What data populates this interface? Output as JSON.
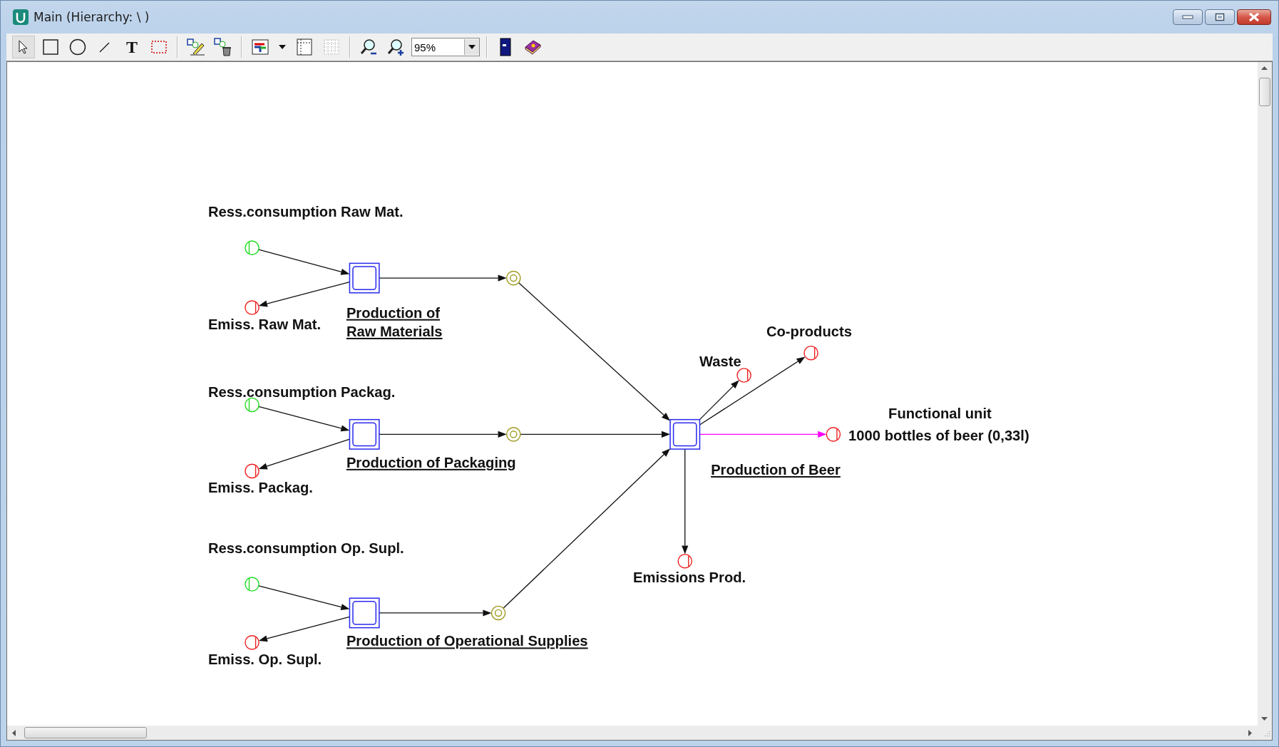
{
  "window": {
    "title": "Main (Hierarchy: \\ )"
  },
  "toolbar": {
    "text_tool": "T",
    "zoom_value": "95%"
  },
  "diagram": {
    "processes": [
      {
        "name_lines": [
          "Production of ",
          "Raw Materials"
        ]
      },
      {
        "name_lines": [
          "Production of Packaging"
        ]
      },
      {
        "name_lines": [
          "Production of Operational Supplies"
        ]
      },
      {
        "name_lines": [
          "Production of Beer"
        ]
      }
    ],
    "flows": [
      {
        "kind": "input",
        "label_lines": [
          "Ress.consumption Raw Mat."
        ]
      },
      {
        "kind": "output",
        "label_lines": [
          "Emiss. Raw Mat."
        ]
      },
      {
        "kind": "intermediate"
      },
      {
        "kind": "input",
        "label_lines": [
          "Ress.consumption Packag."
        ]
      },
      {
        "kind": "output",
        "label_lines": [
          "Emiss. Packag."
        ]
      },
      {
        "kind": "intermediate"
      },
      {
        "kind": "input",
        "label_lines": [
          "Ress.consumption Op. Supl."
        ]
      },
      {
        "kind": "output",
        "label_lines": [
          "Emiss. Op. Supl."
        ]
      },
      {
        "kind": "intermediate"
      },
      {
        "kind": "output",
        "label_lines": [
          "Waste"
        ]
      },
      {
        "kind": "output",
        "label_lines": [
          "Co-products"
        ]
      },
      {
        "kind": "reference",
        "label_lines": [
          "Functional unit",
          "1000 bottles of beer (0,33l)"
        ]
      },
      {
        "kind": "output",
        "label_lines": [
          "Emissions Prod."
        ]
      }
    ]
  }
}
